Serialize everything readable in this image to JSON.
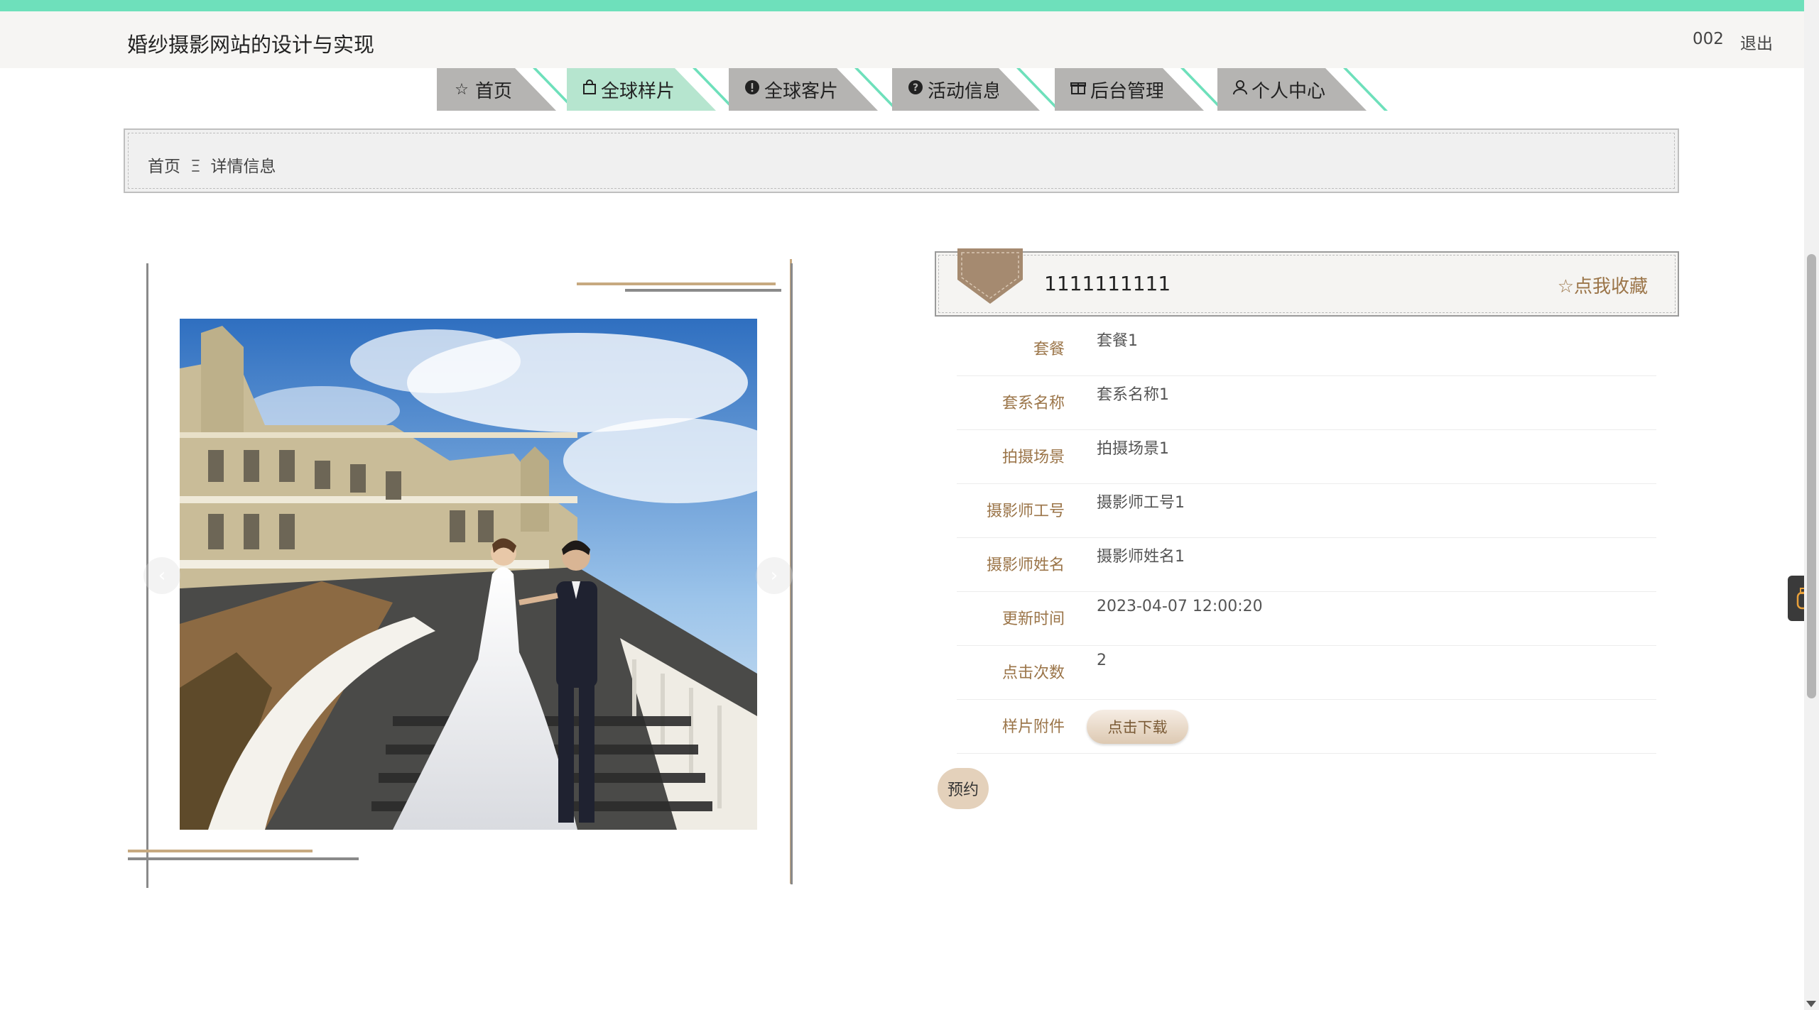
{
  "header": {
    "site_title": "婚纱摄影网站的设计与实现",
    "user": "002",
    "logout": "退出"
  },
  "nav": {
    "tabs": [
      {
        "label": "首页",
        "icon": "star-outline-icon",
        "active": false
      },
      {
        "label": "全球样片",
        "icon": "shopping-bag-icon",
        "active": true
      },
      {
        "label": "全球客片",
        "icon": "exclamation-circle-icon",
        "active": false
      },
      {
        "label": "活动信息",
        "icon": "question-circle-icon",
        "active": false
      },
      {
        "label": "后台管理",
        "icon": "gift-box-icon",
        "active": false
      },
      {
        "label": "个人中心",
        "icon": "user-icon",
        "active": false
      }
    ]
  },
  "breadcrumb": {
    "home": "首页",
    "separator": "Ξ",
    "current": "详情信息"
  },
  "gallery": {
    "prev_arrow": "‹",
    "next_arrow": "›"
  },
  "detail": {
    "title": "1111111111",
    "favorite": "☆点我收藏",
    "fields": [
      {
        "label": "套餐",
        "value": "套餐1"
      },
      {
        "label": "套系名称",
        "value": "套系名称1"
      },
      {
        "label": "拍摄场景",
        "value": "拍摄场景1"
      },
      {
        "label": "摄影师工号",
        "value": "摄影师工号1"
      },
      {
        "label": "摄影师姓名",
        "value": "摄影师姓名1"
      },
      {
        "label": "更新时间",
        "value": "2023-04-07 12:00:20"
      },
      {
        "label": "点击次数",
        "value": "2"
      }
    ],
    "attachment_label": "样片附件",
    "download_button": "点击下载",
    "book_button": "预约"
  },
  "colors": {
    "accent_green": "#6ee0bb",
    "tab_gray": "#b5b4b2",
    "tab_active": "#b6e5cf",
    "label_brown": "#9b7549",
    "badge_brown": "#a58a70"
  }
}
